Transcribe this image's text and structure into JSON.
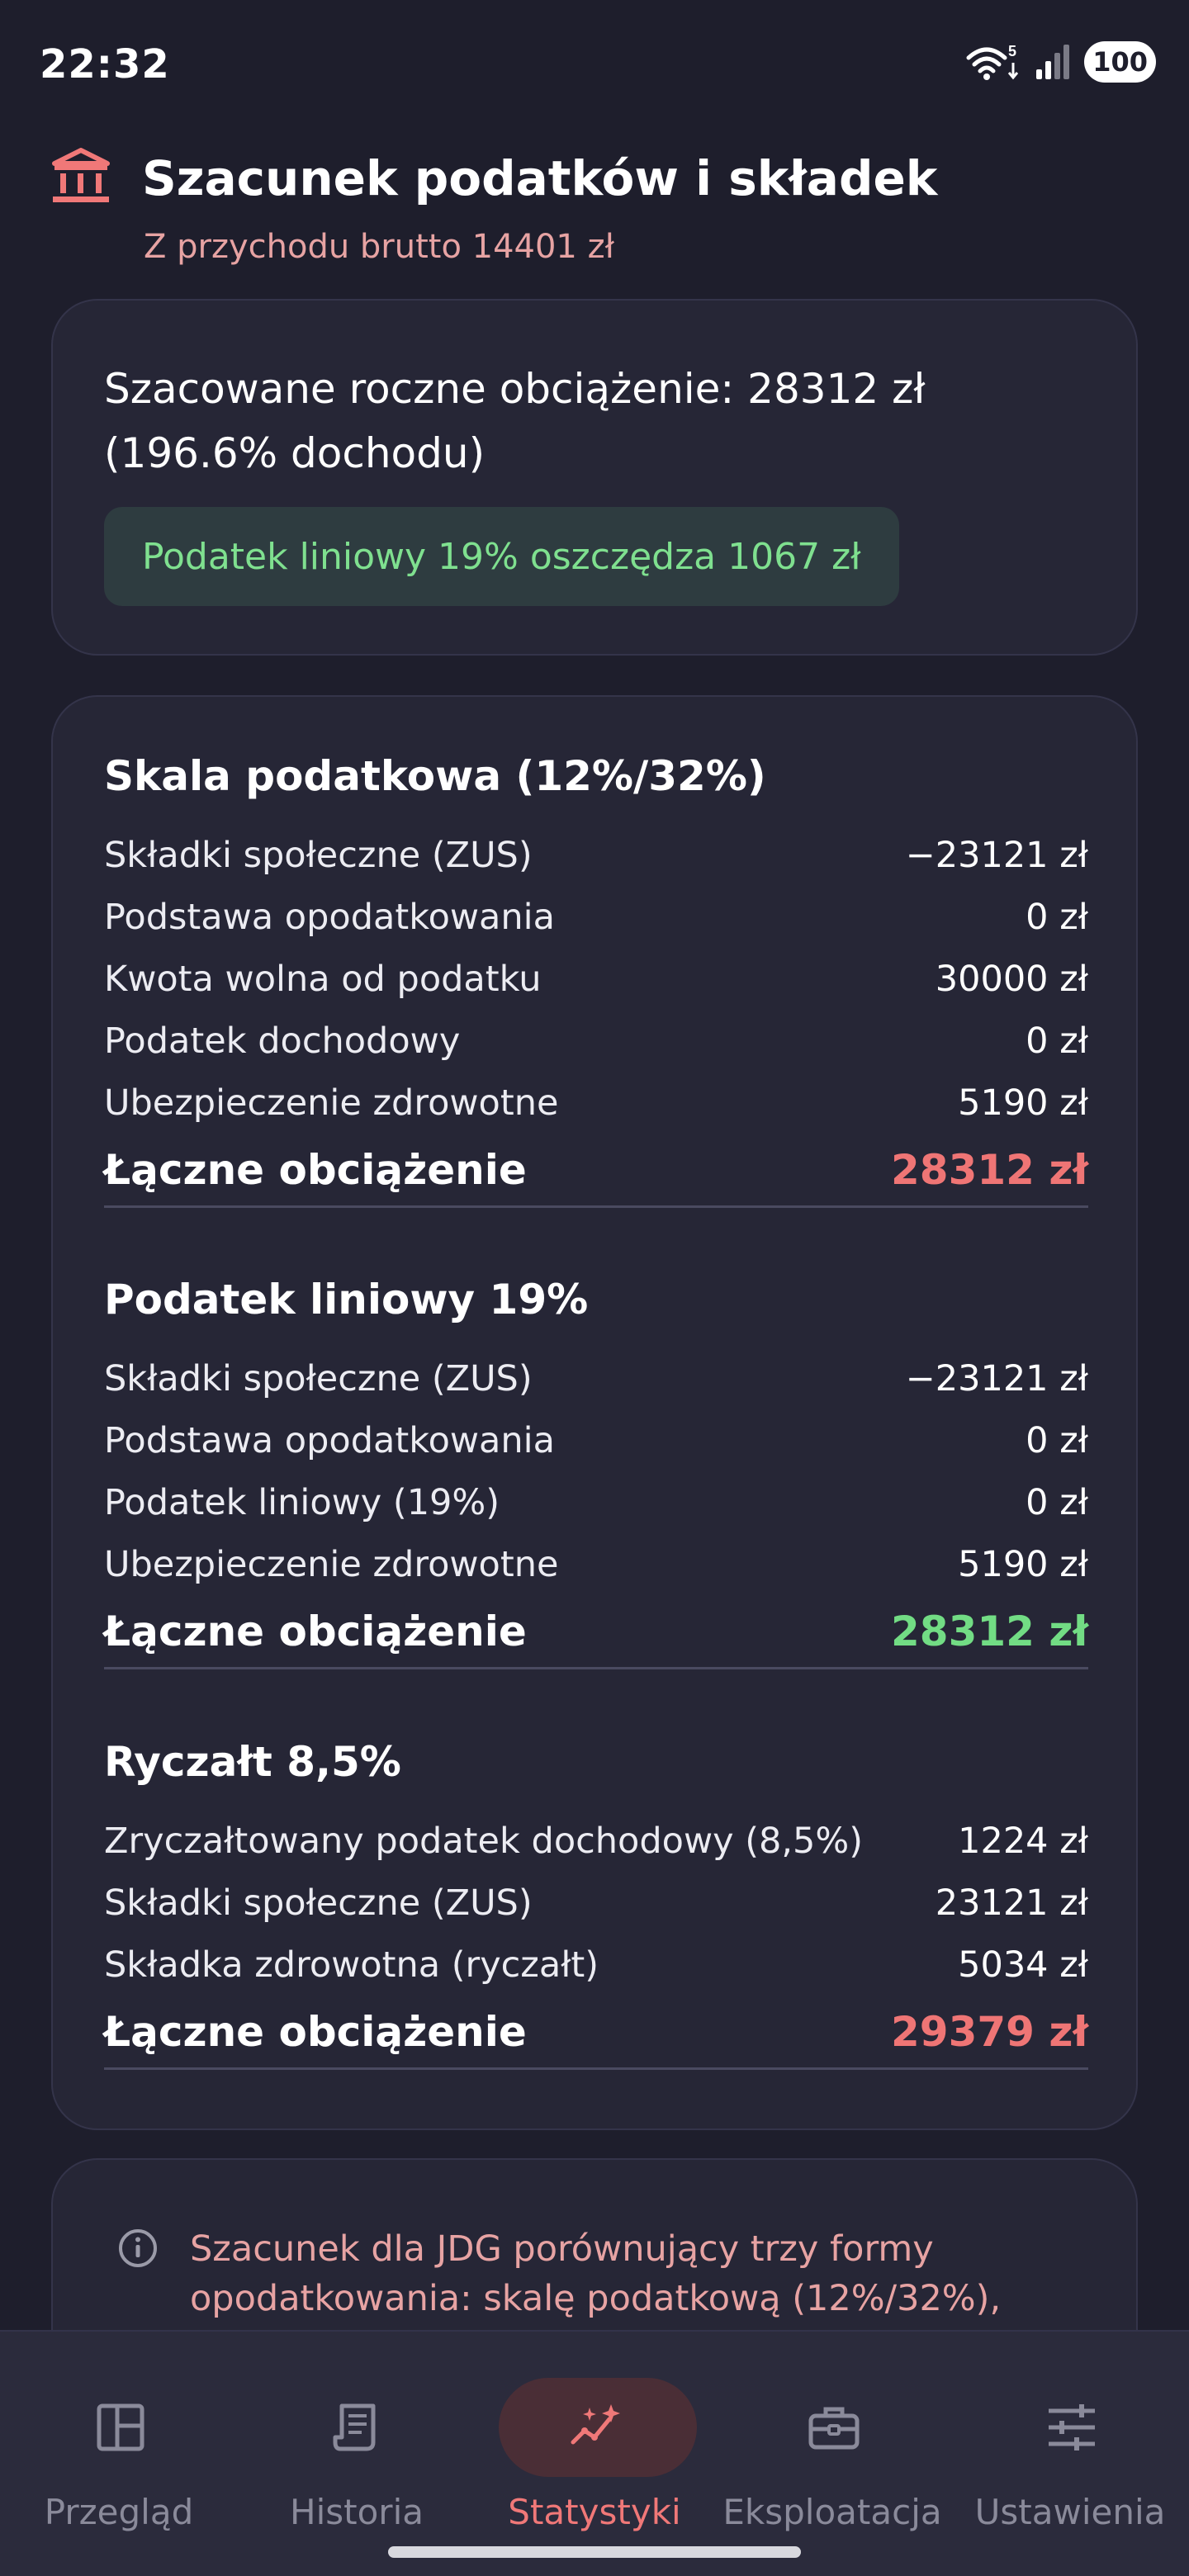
{
  "status_bar": {
    "time": "22:32",
    "battery": "100",
    "wifi_badge": "5"
  },
  "header": {
    "title": "Szacunek podatków i składek",
    "subtitle": "Z przychodu brutto 14401 zł",
    "icon": "bank-icon",
    "accent_color": "#f07878"
  },
  "summary": {
    "text": "Szacowane roczne obciążenie: 28312 zł (196.6% dochodu)",
    "savings": "Podatek liniowy 19% oszczędza 1067 zł"
  },
  "sections": [
    {
      "title": "Skala podatkowa (12%/32%)",
      "rows": [
        {
          "label": "Składki społeczne (ZUS)",
          "value": "−23121 zł"
        },
        {
          "label": "Podstawa opodatkowania",
          "value": "0 zł"
        },
        {
          "label": "Kwota wolna od podatku",
          "value": "30000 zł"
        },
        {
          "label": "Podatek dochodowy",
          "value": "0 zł"
        },
        {
          "label": "Ubezpieczenie zdrowotne",
          "value": "5190 zł"
        }
      ],
      "total_label": "Łączne obciążenie",
      "total_value": "28312 zł",
      "total_color": "#ef7575"
    },
    {
      "title": "Podatek liniowy 19%",
      "rows": [
        {
          "label": "Składki społeczne (ZUS)",
          "value": "−23121 zł"
        },
        {
          "label": "Podstawa opodatkowania",
          "value": "0 zł"
        },
        {
          "label": "Podatek liniowy (19%)",
          "value": "0 zł"
        },
        {
          "label": "Ubezpieczenie zdrowotne",
          "value": "5190 zł"
        }
      ],
      "total_label": "Łączne obciążenie",
      "total_value": "28312 zł",
      "total_color": "#72dc84"
    },
    {
      "title": "Ryczałt 8,5%",
      "rows": [
        {
          "label": "Zryczałtowany podatek dochodowy (8,5%)",
          "value": "1224 zł"
        },
        {
          "label": "Składki społeczne (ZUS)",
          "value": "23121 zł"
        },
        {
          "label": "Składka zdrowotna (ryczałt)",
          "value": "5034 zł"
        }
      ],
      "total_label": "Łączne obciążenie",
      "total_value": "29379 zł",
      "total_color": "#ef7575"
    }
  ],
  "info": {
    "icon": "info-icon",
    "text": "Szacunek dla JDG porównujący trzy formy opodatkowania: skalę podatkową (12%/32%),"
  },
  "nav": {
    "active": "Statystyki",
    "items": [
      {
        "label": "Przegląd",
        "icon": "dashboard-icon"
      },
      {
        "label": "Historia",
        "icon": "receipt-icon"
      },
      {
        "label": "Statystyki",
        "icon": "sparkle-chart-icon"
      },
      {
        "label": "Eksploatacja",
        "icon": "toolbox-icon"
      },
      {
        "label": "Ustawienia",
        "icon": "sliders-icon"
      }
    ]
  }
}
